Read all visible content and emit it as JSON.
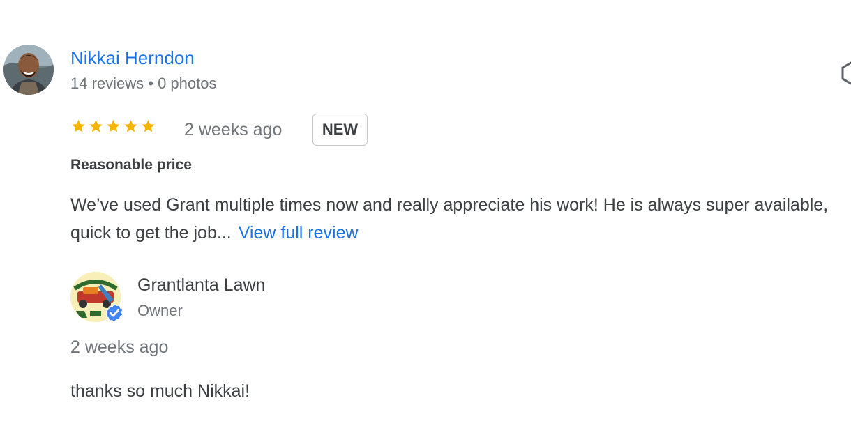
{
  "review": {
    "reviewer_name": "Nikkai Herndon",
    "reviewer_meta": "14 reviews • 0 photos",
    "rating": 5,
    "date": "2 weeks ago",
    "badge": "NEW",
    "subtitle": "Reasonable price",
    "text": "We’ve used Grant multiple times now and really appreciate his work! He is always super available, quick to get the job...",
    "view_full_label": "View full review",
    "star_color": "#f4b400"
  },
  "owner_response": {
    "name": "Grantlanta Lawn",
    "role": "Owner",
    "date": "2 weeks ago",
    "text": "thanks so much Nikkai!",
    "logo_text_top": "GRANTLANTA",
    "logo_text_bottom": "LAWN",
    "verified_color": "#4285f4"
  },
  "icons": {
    "more": "more-vert-icon",
    "star": "star-icon",
    "verified": "verified-check-icon"
  },
  "colors": {
    "link": "#1a73e8",
    "secondary_text": "#70757a",
    "primary_text": "#3c4043"
  }
}
